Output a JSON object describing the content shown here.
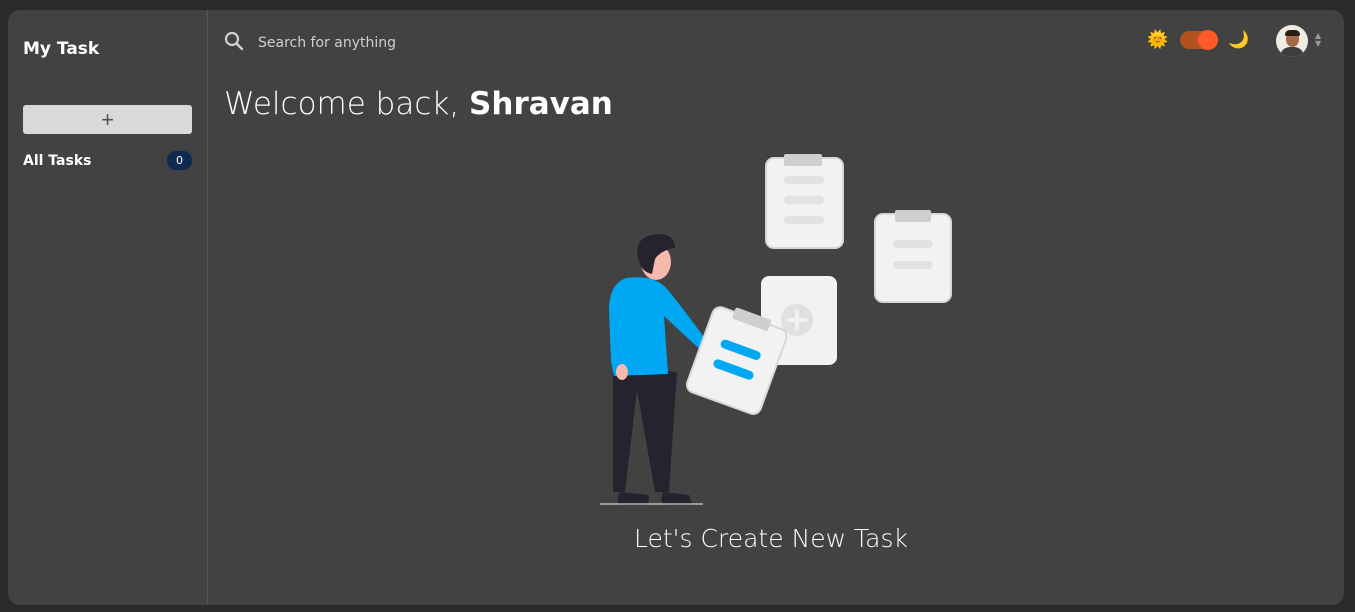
{
  "sidebar": {
    "brand": "My Task",
    "add_button_label": "+",
    "items": [
      {
        "label": "All Tasks",
        "count": "0"
      }
    ]
  },
  "header": {
    "search_placeholder": "Search for anything",
    "icons": [
      "search-icon",
      "sun-icon",
      "theme-toggle",
      "moon-icon",
      "avatar",
      "chevron-updown-icon"
    ],
    "theme_toggle_on": true,
    "accent_color": "#ff5a26"
  },
  "main": {
    "welcome_prefix": "Welcome back, ",
    "user_name": "Shravan",
    "cta": "Let's Create New Task"
  },
  "colors": {
    "background": "#424242",
    "badge": "#0f2a4f",
    "illustration_blue": "#00a8f3"
  }
}
